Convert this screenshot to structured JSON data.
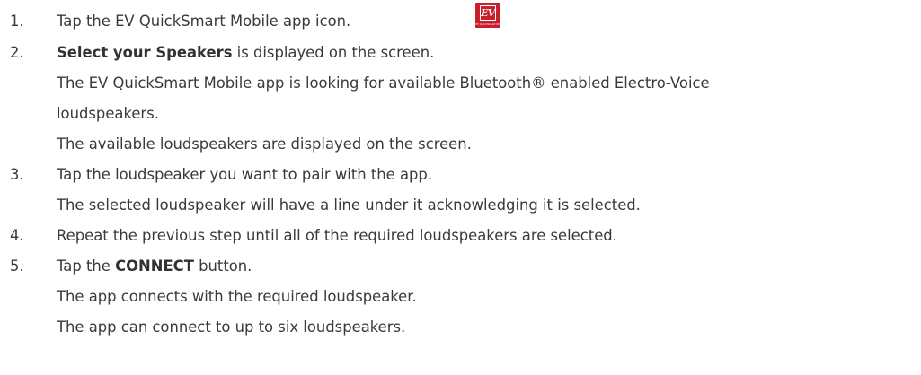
{
  "app_icon": {
    "logo_text": "EV",
    "caption": "EV QuickSmart Mobile",
    "color": "#c8202a"
  },
  "steps": [
    {
      "number": "1.",
      "text_before": "Tap the EV QuickSmart Mobile app icon.",
      "bold": "",
      "text_after": ""
    },
    {
      "number": "2.",
      "text_before": "",
      "bold": "Select your Speakers",
      "text_after": " is displayed on the screen."
    },
    {
      "number": "3.",
      "text_before": "Tap the loudspeaker you want to pair with the app.",
      "bold": "",
      "text_after": ""
    },
    {
      "number": "4.",
      "text_before": "Repeat the previous step until all of the required loudspeakers are selected.",
      "bold": "",
      "text_after": ""
    },
    {
      "number": "5.",
      "text_before": "Tap the ",
      "bold": "CONNECT",
      "text_after": " button."
    }
  ],
  "notes": [
    "The EV QuickSmart Mobile app is looking for available Bluetooth® enabled Electro-Voice",
    "loudspeakers.",
    "The available loudspeakers are displayed on the screen.",
    "The selected loudspeaker will have a line under it acknowledging it is selected.",
    "The app connects with the required loudspeaker.",
    "The app can connect to up to six loudspeakers."
  ]
}
